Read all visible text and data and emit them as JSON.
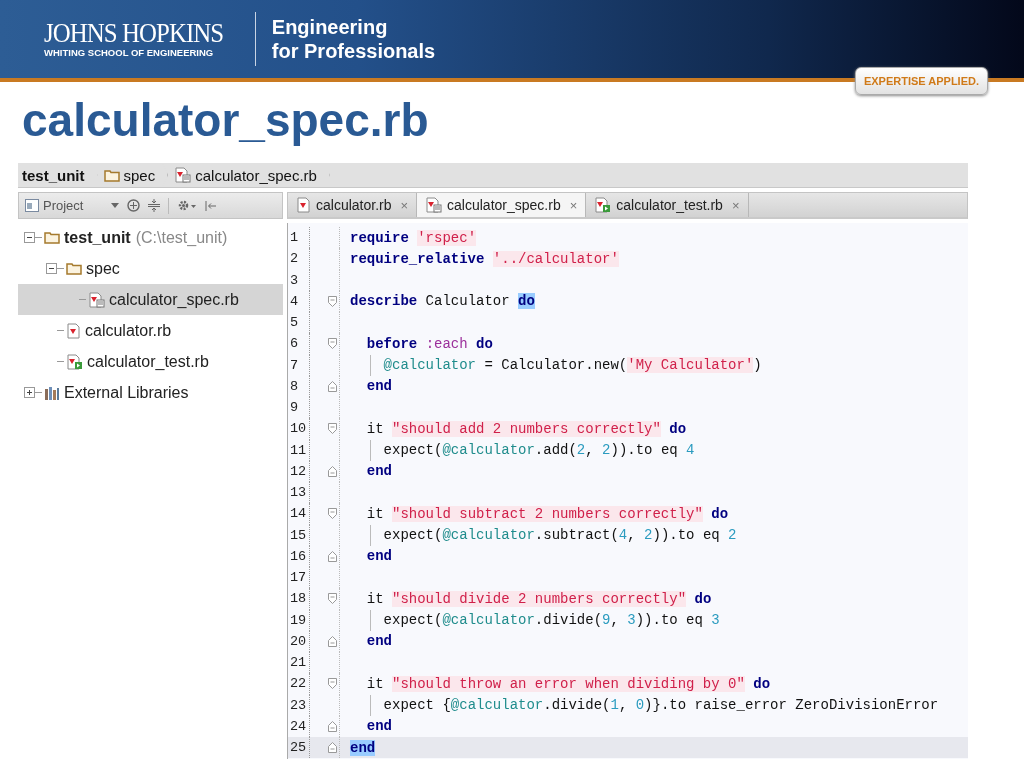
{
  "banner": {
    "university": "JOHNS HOPKINS",
    "school": "WHITING SCHOOL OF ENGINEERING",
    "program_line_1": "Engineering",
    "program_line_2": "for Professionals",
    "tagline": "EXPERTISE APPLIED."
  },
  "slide_title": "calculator_spec.rb",
  "breadcrumbs": [
    {
      "label": "test_unit",
      "kind": "project",
      "bold": true
    },
    {
      "label": "spec",
      "kind": "folder",
      "bold": false
    },
    {
      "label": "calculator_spec.rb",
      "kind": "spec",
      "bold": false
    }
  ],
  "project_panel": {
    "title": "Project",
    "tree": [
      {
        "label": "test_unit",
        "note": "(C:\\test_unit)",
        "kind": "folder",
        "bold": true,
        "expanded": true,
        "selected": false,
        "children": [
          {
            "label": "spec",
            "kind": "folder",
            "bold": false,
            "expanded": true,
            "selected": false,
            "children": [
              {
                "label": "calculator_spec.rb",
                "kind": "spec",
                "bold": false,
                "selected": true
              }
            ]
          },
          {
            "label": "calculator.rb",
            "kind": "ruby",
            "bold": false,
            "selected": false
          },
          {
            "label": "calculator_test.rb",
            "kind": "test",
            "bold": false,
            "selected": false
          }
        ]
      },
      {
        "label": "External Libraries",
        "kind": "library",
        "bold": false,
        "expanded": false,
        "selected": false
      }
    ]
  },
  "tabs": [
    {
      "label": "calculator.rb",
      "kind": "ruby",
      "close": "×",
      "selected": false
    },
    {
      "label": "calculator_spec.rb",
      "kind": "spec",
      "close": "×",
      "selected": true
    },
    {
      "label": "calculator_test.rb",
      "kind": "test",
      "close": "×",
      "selected": false
    }
  ],
  "editor": {
    "lines": [
      {
        "number": "1",
        "fold_start": false,
        "fold_end": false,
        "guide": false,
        "current": false,
        "tokens": [
          {
            "kind": "keyword",
            "text": "require "
          },
          {
            "kind": "string",
            "text": "'rspec'"
          }
        ]
      },
      {
        "number": "2",
        "fold_start": false,
        "fold_end": false,
        "guide": false,
        "current": false,
        "tokens": [
          {
            "kind": "keyword",
            "text": "require_relative "
          },
          {
            "kind": "string",
            "text": "'../calculator'"
          }
        ]
      },
      {
        "number": "3",
        "fold_start": false,
        "fold_end": false,
        "guide": false,
        "current": false
      },
      {
        "number": "4",
        "fold_start": true,
        "fold_end": false,
        "guide": false,
        "current": false,
        "tokens": [
          {
            "kind": "keyword",
            "text": "describe"
          },
          {
            "kind": "plain",
            "text": " Calculator "
          },
          {
            "kind": "match",
            "text": "do"
          }
        ]
      },
      {
        "number": "5",
        "fold_start": false,
        "fold_end": false,
        "guide": false,
        "current": false
      },
      {
        "number": "6",
        "fold_start": true,
        "fold_end": false,
        "guide": false,
        "current": false,
        "tokens": [
          {
            "kind": "keyword",
            "text": "  before "
          },
          {
            "kind": "symbol",
            "text": ":each"
          },
          {
            "kind": "keyword",
            "text": " do"
          }
        ]
      },
      {
        "number": "7",
        "fold_start": false,
        "fold_end": false,
        "guide": true,
        "current": false,
        "tokens": [
          {
            "kind": "ivar",
            "text": "    @calculator"
          },
          {
            "kind": "plain",
            "text": " = Calculator.new("
          },
          {
            "kind": "string",
            "text": "'My Calculator'"
          },
          {
            "kind": "plain",
            "text": ")"
          }
        ]
      },
      {
        "number": "8",
        "fold_start": false,
        "fold_end": true,
        "guide": false,
        "current": false,
        "tokens": [
          {
            "kind": "keyword",
            "text": "  end"
          }
        ]
      },
      {
        "number": "9",
        "fold_start": false,
        "fold_end": false,
        "guide": false,
        "current": false
      },
      {
        "number": "10",
        "fold_start": true,
        "fold_end": false,
        "guide": false,
        "current": false,
        "tokens": [
          {
            "kind": "plain",
            "text": "  it "
          },
          {
            "kind": "string",
            "text": "\"should add 2 numbers correctly\""
          },
          {
            "kind": "keyword",
            "text": " do"
          }
        ]
      },
      {
        "number": "11",
        "fold_start": false,
        "fold_end": false,
        "guide": true,
        "current": false,
        "tokens": [
          {
            "kind": "plain",
            "text": "    expect("
          },
          {
            "kind": "ivar",
            "text": "@calculator"
          },
          {
            "kind": "plain",
            "text": ".add("
          },
          {
            "kind": "number",
            "text": "2"
          },
          {
            "kind": "plain",
            "text": ", "
          },
          {
            "kind": "number",
            "text": "2"
          },
          {
            "kind": "plain",
            "text": ")).to eq "
          },
          {
            "kind": "number",
            "text": "4"
          }
        ]
      },
      {
        "number": "12",
        "fold_start": false,
        "fold_end": true,
        "guide": false,
        "current": false,
        "tokens": [
          {
            "kind": "keyword",
            "text": "  end"
          }
        ]
      },
      {
        "number": "13",
        "fold_start": false,
        "fold_end": false,
        "guide": false,
        "current": false
      },
      {
        "number": "14",
        "fold_start": true,
        "fold_end": false,
        "guide": false,
        "current": false,
        "tokens": [
          {
            "kind": "plain",
            "text": "  it "
          },
          {
            "kind": "string",
            "text": "\"should subtract 2 numbers correctly\""
          },
          {
            "kind": "keyword",
            "text": " do"
          }
        ]
      },
      {
        "number": "15",
        "fold_start": false,
        "fold_end": false,
        "guide": true,
        "current": false,
        "tokens": [
          {
            "kind": "plain",
            "text": "    expect("
          },
          {
            "kind": "ivar",
            "text": "@calculator"
          },
          {
            "kind": "plain",
            "text": ".subtract("
          },
          {
            "kind": "number",
            "text": "4"
          },
          {
            "kind": "plain",
            "text": ", "
          },
          {
            "kind": "number",
            "text": "2"
          },
          {
            "kind": "plain",
            "text": ")).to eq "
          },
          {
            "kind": "number",
            "text": "2"
          }
        ]
      },
      {
        "number": "16",
        "fold_start": false,
        "fold_end": true,
        "guide": false,
        "current": false,
        "tokens": [
          {
            "kind": "keyword",
            "text": "  end"
          }
        ]
      },
      {
        "number": "17",
        "fold_start": false,
        "fold_end": false,
        "guide": false,
        "current": false
      },
      {
        "number": "18",
        "fold_start": true,
        "fold_end": false,
        "guide": false,
        "current": false,
        "tokens": [
          {
            "kind": "plain",
            "text": "  it "
          },
          {
            "kind": "string",
            "text": "\"should divide 2 numbers correctly\""
          },
          {
            "kind": "keyword",
            "text": " do"
          }
        ]
      },
      {
        "number": "19",
        "fold_start": false,
        "fold_end": false,
        "guide": true,
        "current": false,
        "tokens": [
          {
            "kind": "plain",
            "text": "    expect("
          },
          {
            "kind": "ivar",
            "text": "@calculator"
          },
          {
            "kind": "plain",
            "text": ".divide("
          },
          {
            "kind": "number",
            "text": "9"
          },
          {
            "kind": "plain",
            "text": ", "
          },
          {
            "kind": "number",
            "text": "3"
          },
          {
            "kind": "plain",
            "text": ")).to eq "
          },
          {
            "kind": "number",
            "text": "3"
          }
        ]
      },
      {
        "number": "20",
        "fold_start": false,
        "fold_end": true,
        "guide": false,
        "current": false,
        "tokens": [
          {
            "kind": "keyword",
            "text": "  end"
          }
        ]
      },
      {
        "number": "21",
        "fold_start": false,
        "fold_end": false,
        "guide": false,
        "current": false
      },
      {
        "number": "22",
        "fold_start": true,
        "fold_end": false,
        "guide": false,
        "current": false,
        "tokens": [
          {
            "kind": "plain",
            "text": "  it "
          },
          {
            "kind": "string",
            "text": "\"should throw an error when dividing by 0\""
          },
          {
            "kind": "keyword",
            "text": " do"
          }
        ]
      },
      {
        "number": "23",
        "fold_start": false,
        "fold_end": false,
        "guide": true,
        "current": false,
        "tokens": [
          {
            "kind": "plain",
            "text": "    expect {"
          },
          {
            "kind": "ivar",
            "text": "@calculator"
          },
          {
            "kind": "plain",
            "text": ".divide("
          },
          {
            "kind": "number",
            "text": "1"
          },
          {
            "kind": "plain",
            "text": ", "
          },
          {
            "kind": "number",
            "text": "0"
          },
          {
            "kind": "plain",
            "text": ")}.to raise_error ZeroDivisionError"
          }
        ]
      },
      {
        "number": "24",
        "fold_start": false,
        "fold_end": true,
        "guide": false,
        "current": false,
        "tokens": [
          {
            "kind": "keyword",
            "text": "  end"
          }
        ]
      },
      {
        "number": "25",
        "fold_start": false,
        "fold_end": true,
        "guide": false,
        "current": true,
        "tokens": [
          {
            "kind": "match",
            "text": "end"
          }
        ]
      }
    ]
  }
}
